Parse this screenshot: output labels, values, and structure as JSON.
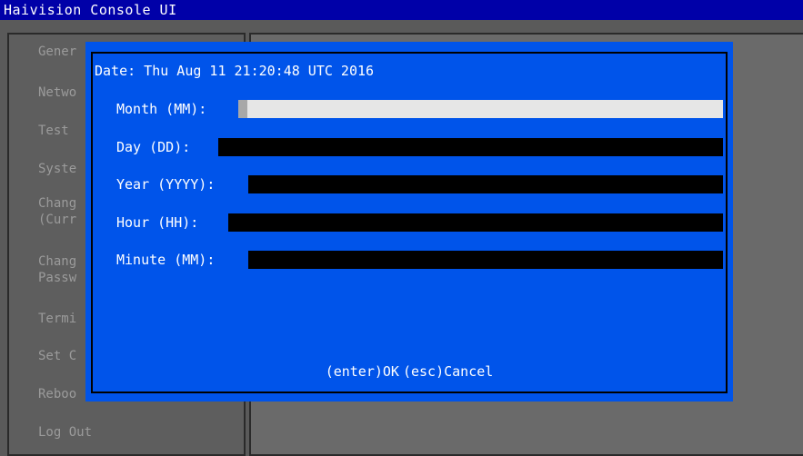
{
  "app": {
    "title": "Haivision Console UI"
  },
  "sidebar": {
    "items": [
      {
        "label": "Gener"
      },
      {
        "label": "Netwo"
      },
      {
        "label": "Test"
      },
      {
        "label": "Syste"
      },
      {
        "label": "Chang\n(Curr"
      },
      {
        "label": "Chang\nPassw"
      },
      {
        "label": "Termi"
      },
      {
        "label": "Set C"
      },
      {
        "label": "Reboo"
      },
      {
        "label": "Log Out"
      }
    ]
  },
  "dialog": {
    "date_line": "Date: Thu Aug 11 21:20:48 UTC 2016",
    "fields": [
      {
        "label": "Month (MM):",
        "value": ""
      },
      {
        "label": "Day (DD):",
        "value": ""
      },
      {
        "label": "Year (YYYY):",
        "value": ""
      },
      {
        "label": "Hour (HH):",
        "value": ""
      },
      {
        "label": "Minute (MM):",
        "value": ""
      }
    ],
    "ok_label": "(enter)OK",
    "cancel_label": "(esc)Cancel"
  }
}
